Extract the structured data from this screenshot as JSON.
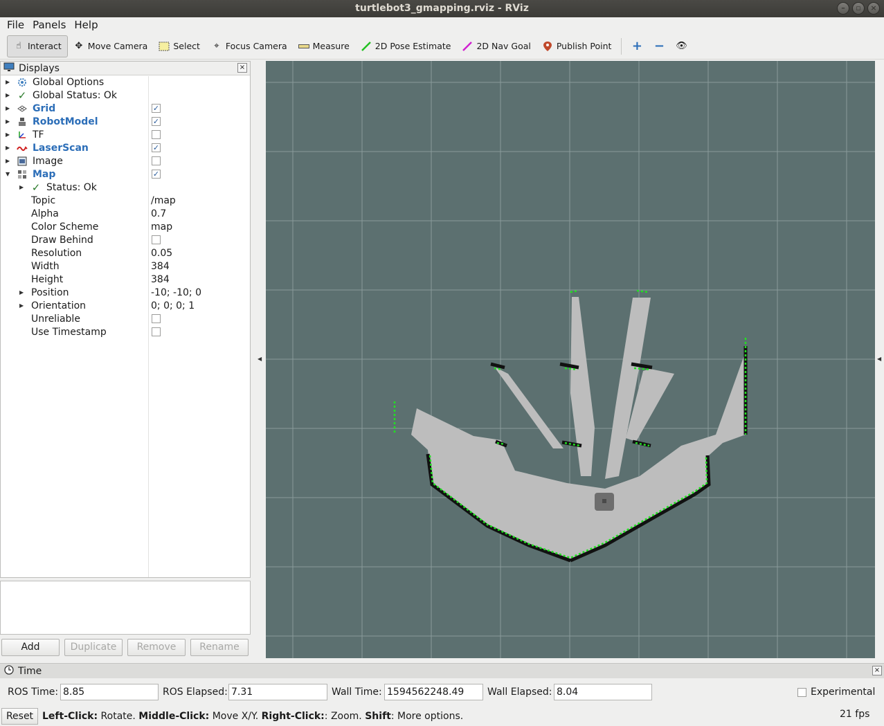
{
  "window": {
    "title": "turtlebot3_gmapping.rviz - RViz"
  },
  "menubar": {
    "items": [
      "File",
      "Panels",
      "Help"
    ]
  },
  "toolbar": {
    "interact": "Interact",
    "move_camera": "Move Camera",
    "select": "Select",
    "focus_camera": "Focus Camera",
    "measure": "Measure",
    "pose_estimate": "2D Pose Estimate",
    "nav_goal": "2D Nav Goal",
    "publish_point": "Publish Point"
  },
  "displays": {
    "title": "Displays",
    "items": {
      "global_options": "Global Options",
      "global_status": "Global Status: Ok",
      "grid": "Grid",
      "robot_model": "RobotModel",
      "tf": "TF",
      "laser_scan": "LaserScan",
      "image": "Image",
      "map": "Map"
    },
    "checks": {
      "grid": true,
      "robot_model": true,
      "tf": false,
      "laser_scan": true,
      "image": false,
      "map": true
    },
    "map_props": {
      "status": "Status: Ok",
      "topic_label": "Topic",
      "topic": "/map",
      "alpha_label": "Alpha",
      "alpha": "0.7",
      "color_scheme_label": "Color Scheme",
      "color_scheme": "map",
      "draw_behind_label": "Draw Behind",
      "draw_behind": false,
      "resolution_label": "Resolution",
      "resolution": "0.05",
      "width_label": "Width",
      "width": "384",
      "height_label": "Height",
      "height": "384",
      "position_label": "Position",
      "position": "-10; -10; 0",
      "orientation_label": "Orientation",
      "orientation": "0; 0; 0; 1",
      "unreliable_label": "Unreliable",
      "unreliable": false,
      "use_timestamp_label": "Use Timestamp",
      "use_timestamp": false
    },
    "buttons": {
      "add": "Add",
      "duplicate": "Duplicate",
      "remove": "Remove",
      "rename": "Rename"
    }
  },
  "time": {
    "title": "Time",
    "ros_time_label": "ROS Time:",
    "ros_time": "8.85",
    "ros_elapsed_label": "ROS Elapsed:",
    "ros_elapsed": "7.31",
    "wall_time_label": "Wall Time:",
    "wall_time": "1594562248.49",
    "wall_elapsed_label": "Wall Elapsed:",
    "wall_elapsed": "8.04",
    "experimental_label": "Experimental",
    "experimental": false
  },
  "statusbar": {
    "reset": "Reset",
    "hint_left_key": "Left-Click:",
    "hint_left": " Rotate. ",
    "hint_middle_key": "Middle-Click:",
    "hint_middle": " Move X/Y. ",
    "hint_right_key": "Right-Click:",
    "hint_right": ": Zoom. ",
    "hint_shift_key": "Shift",
    "hint_shift": ": More options.",
    "fps": "21 fps"
  },
  "colors": {
    "viewport_bg": "#5c7070",
    "grid_line": "#8a9a9a",
    "map_free": "#bdbdbd",
    "map_occupied": "#111111",
    "laser": "#22e022",
    "robot": "#6e6e6e",
    "accent_blue": "#2c6eb8"
  }
}
